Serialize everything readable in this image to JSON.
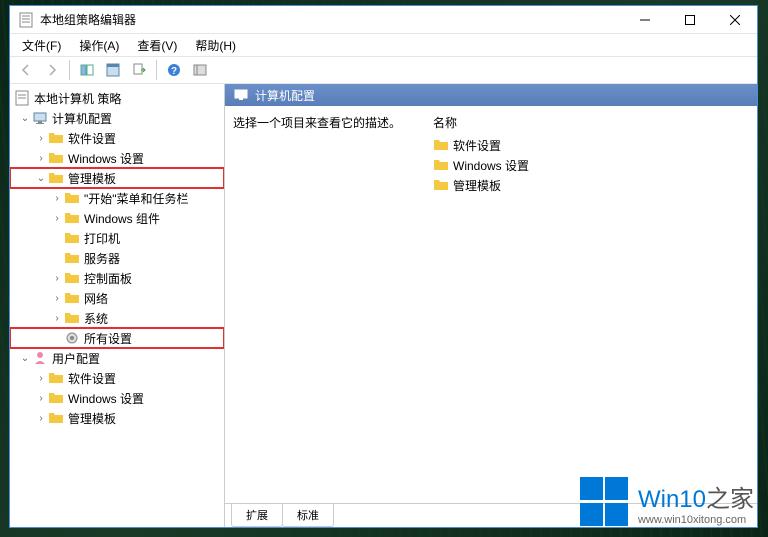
{
  "window": {
    "title": "本地组策略编辑器"
  },
  "menubar": {
    "file": "文件(F)",
    "action": "操作(A)",
    "view": "查看(V)",
    "help": "帮助(H)"
  },
  "tree": {
    "root": "本地计算机 策略",
    "computer_config": "计算机配置",
    "software_settings": "软件设置",
    "windows_settings": "Windows 设置",
    "admin_templates": "管理模板",
    "start_menu": "\"开始\"菜单和任务栏",
    "windows_components": "Windows 组件",
    "printers": "打印机",
    "servers": "服务器",
    "control_panel": "控制面板",
    "network": "网络",
    "system": "系统",
    "all_settings": "所有设置",
    "user_config": "用户配置",
    "user_software_settings": "软件设置",
    "user_windows_settings": "Windows 设置",
    "user_admin_templates": "管理模板"
  },
  "right": {
    "header": "计算机配置",
    "description": "选择一个项目来查看它的描述。",
    "list_header": "名称",
    "items": {
      "software": "软件设置",
      "windows": "Windows 设置",
      "admin": "管理模板"
    }
  },
  "tabs": {
    "extended": "扩展",
    "standard": "标准"
  },
  "watermark": {
    "brand": "Win10",
    "suffix": "之家",
    "url": "www.win10xitong.com"
  }
}
